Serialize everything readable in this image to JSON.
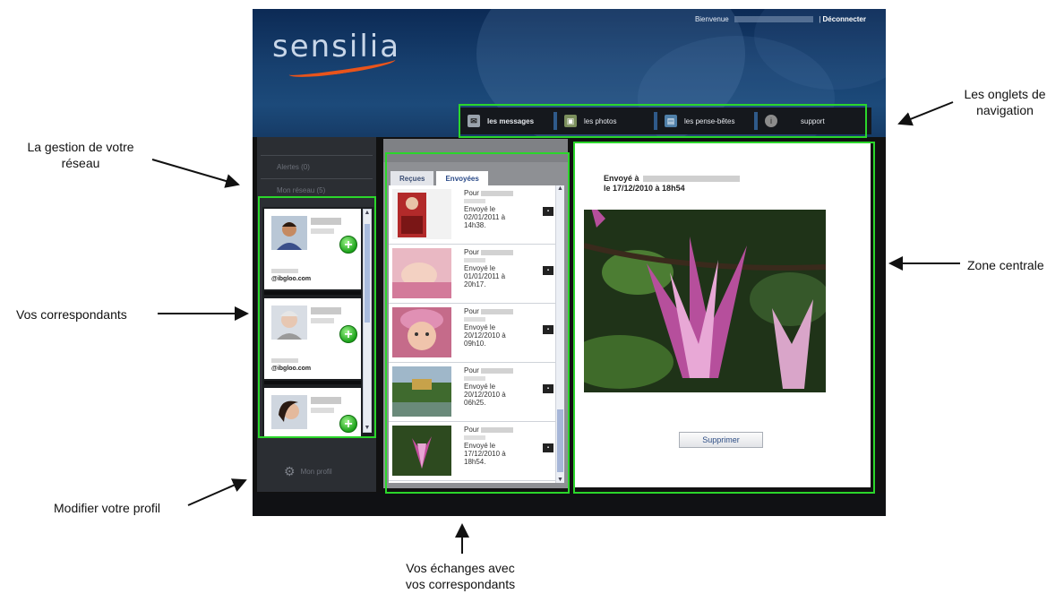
{
  "annotations": {
    "network": "La gestion de votre réseau",
    "contacts": "Vos correspondants",
    "profile": "Modifier votre profil",
    "exchanges": "Vos échanges avec vos correspondants",
    "tabs": "Les onglets de navigation",
    "center": "Zone centrale"
  },
  "header": {
    "logo": "sensilia",
    "welcome": "Bienvenue",
    "separator": "|",
    "logout": "Déconnecter"
  },
  "nav": {
    "items": [
      {
        "label": "les messages",
        "icon": "message-icon"
      },
      {
        "label": "les photos",
        "icon": "photos-icon"
      },
      {
        "label": "les pense-bêtes",
        "icon": "notes-icon"
      },
      {
        "label": "support",
        "icon": "support-icon"
      }
    ]
  },
  "sidebar": {
    "alerts": "Alertes (0)",
    "network": "Mon réseau (5)",
    "profile": "Mon profil",
    "contacts": [
      {
        "email": "@ibgloo.com"
      },
      {
        "email": "@ibgloo.com"
      },
      {
        "email": ""
      }
    ]
  },
  "messages": {
    "tab_received": "Reçues",
    "tab_sent": "Envoyées",
    "items": [
      {
        "to": "Pour",
        "sent": "Envoyé le",
        "date": "02/01/2011 à",
        "time": "14h38."
      },
      {
        "to": "Pour",
        "sent": "Envoyé le",
        "date": "01/01/2011 à",
        "time": "20h17."
      },
      {
        "to": "Pour",
        "sent": "Envoyé le",
        "date": "20/12/2010 à",
        "time": "09h10."
      },
      {
        "to": "Pour",
        "sent": "Envoyé le",
        "date": "20/12/2010 à",
        "time": "06h25."
      },
      {
        "to": "Pour",
        "sent": "Envoyé le",
        "date": "17/12/2010 à",
        "time": "18h54."
      }
    ]
  },
  "center": {
    "sent_to": "Envoyé à",
    "sent_date": "le 17/12/2010 à 18h54",
    "delete": "Supprimer"
  }
}
